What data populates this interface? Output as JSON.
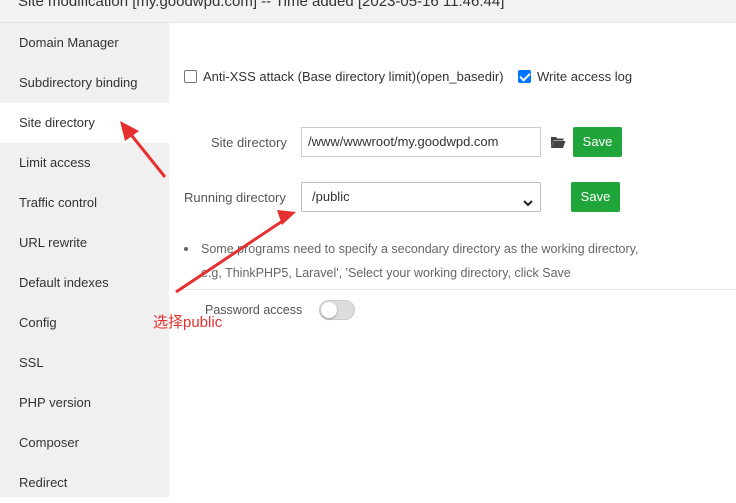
{
  "window": {
    "title": "Site modification [my.goodwpd.com] -- Time added [2023-05-16 11:46:44]"
  },
  "sidebar": {
    "items": [
      {
        "label": "Domain Manager"
      },
      {
        "label": "Subdirectory binding"
      },
      {
        "label": "Site directory",
        "active": true
      },
      {
        "label": "Limit access"
      },
      {
        "label": "Traffic control"
      },
      {
        "label": "URL rewrite"
      },
      {
        "label": "Default indexes"
      },
      {
        "label": "Config"
      },
      {
        "label": "SSL"
      },
      {
        "label": "PHP version"
      },
      {
        "label": "Composer"
      },
      {
        "label": "Redirect"
      }
    ]
  },
  "options": {
    "anti_xss_label": "Anti-XSS attack (Base directory limit)(open_basedir)",
    "anti_xss_checked": false,
    "access_log_label": "Write access log",
    "access_log_checked": true
  },
  "site_directory": {
    "label": "Site directory",
    "value": "/www/wwwroot/my.goodwpd.com",
    "save_label": "Save",
    "folder_icon": "folder-open-icon"
  },
  "running_directory": {
    "label": "Running directory",
    "selected": "/public",
    "save_label": "Save"
  },
  "notes": {
    "line1": "Some programs need to specify a secondary directory as the working directory,",
    "line2": "e.g, ThinkPHP5, Laravel', 'Select your working directory, click Save"
  },
  "password_access": {
    "label": "Password access",
    "enabled": false
  },
  "annotation": {
    "text": "选择public",
    "color": "#e63030"
  },
  "colors": {
    "save_button": "#20a53a",
    "checkbox_checked": "#0075ff",
    "sidebar_bg": "#f0f0f0"
  }
}
